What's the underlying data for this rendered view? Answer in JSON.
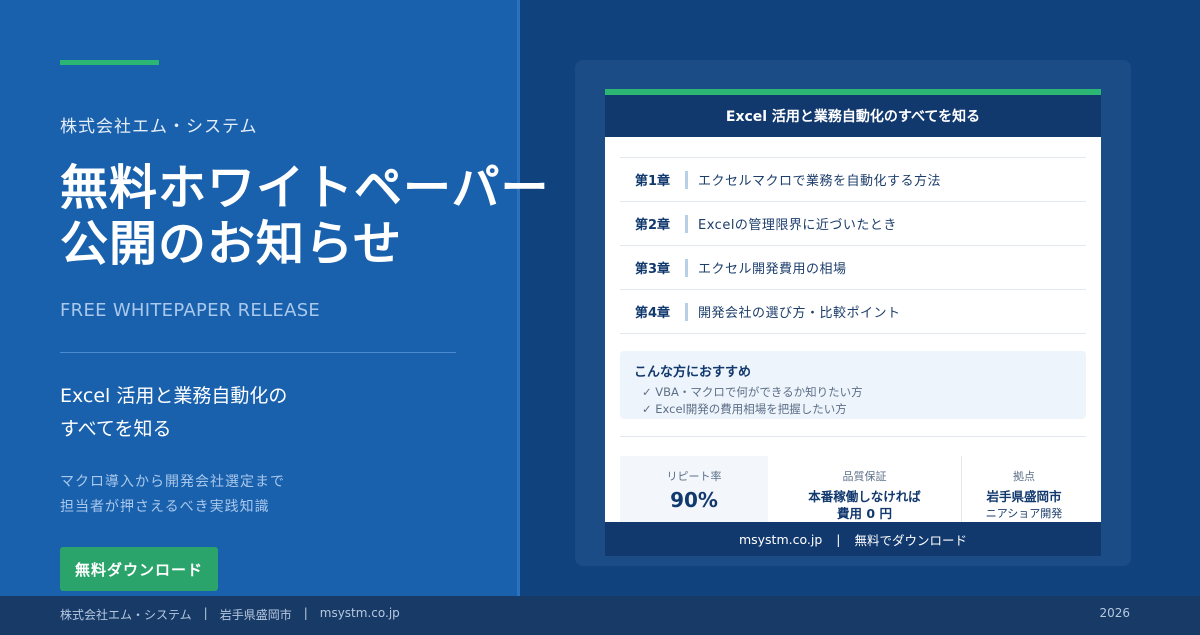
{
  "hero": {
    "company": "株式会社エム・システム",
    "title_line1": "無料ホワイトペーパー",
    "title_line2": "公開のお知らせ",
    "subtitle_en": "FREE WHITEPAPER RELEASE",
    "desc_line1": "Excel 活用と業務自動化の",
    "desc_line2": "すべてを知る",
    "small_line1": "マクロ導入から開発会社選定まで",
    "small_line2": "担当者が押さえるべき実践知識",
    "download_button": "無料ダウンロード"
  },
  "card": {
    "header": "Excel 活用と業務自動化のすべてを知る",
    "chapters": [
      {
        "num": "第1章",
        "title": "エクセルマクロで業務を自動化する方法"
      },
      {
        "num": "第2章",
        "title": "Excelの管理限界に近づいたとき"
      },
      {
        "num": "第3章",
        "title": "エクセル開発費用の相場"
      },
      {
        "num": "第4章",
        "title": "開発会社の選び方・比較ポイント"
      }
    ],
    "recommend": {
      "title": "こんな方におすすめ",
      "items": [
        "✓ VBA・マクロで何ができるか知りたい方",
        "✓ Excel開発の費用相場を把握したい方"
      ]
    },
    "stats": [
      {
        "label": "リピート率",
        "value": "90%"
      },
      {
        "label": "品質保証",
        "value_line1": "本番稼働しなければ",
        "value_line2": "費用 0 円"
      },
      {
        "label": "拠点",
        "value_line1": "岩手県盛岡市",
        "value_line2": "ニアショア開発"
      }
    ],
    "footer_site": "msystm.co.jp",
    "footer_sep": "|",
    "footer_cta": "無料でダウンロード"
  },
  "footer": {
    "company": "株式会社エム・システム",
    "sep": "|",
    "location": "岩手県盛岡市",
    "site": "msystm.co.jp",
    "year": "2026"
  },
  "colors": {
    "left_bg": "#1961ad",
    "right_bg": "#10427e",
    "accent_green": "#2bb673",
    "button_green": "#2aa46a",
    "navy": "#12396e"
  }
}
